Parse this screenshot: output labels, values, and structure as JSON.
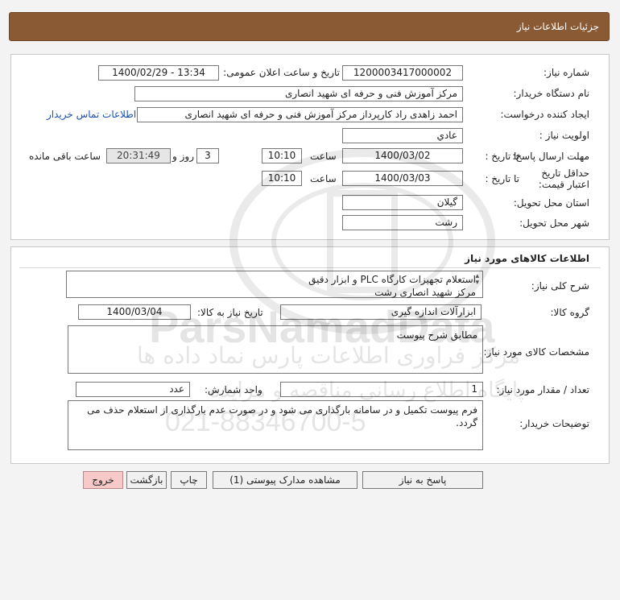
{
  "header": {
    "title": "جزئیات اطلاعات نیاز"
  },
  "info": {
    "need_number_label": "شماره نیاز:",
    "need_number": "1200003417000002",
    "announce_label": "تاریخ و ساعت اعلان عمومی:",
    "announce_value": "1400/02/29 - 13:34",
    "buyer_label": "نام دستگاه خریدار:",
    "buyer_value": "مرکز آموزش فنی و حرفه ای شهید انصاری",
    "creator_label": "ایجاد کننده درخواست:",
    "creator_value": "احمد زاهدی راد کارپرداز مرکز آموزش فنی و حرفه ای شهید انصاری",
    "contact_link": "اطلاعات تماس خریدار",
    "priority_label": "اولویت نیاز :",
    "priority_value": "عادي",
    "deadline_label": "مهلت ارسال پاسخ:",
    "until_date_label": "تا تاریخ :",
    "deadline_date": "1400/03/02",
    "time_label": "ساعت",
    "deadline_time": "10:10",
    "days_value": "3",
    "days_label": "روز و",
    "remaining_time": "20:31:49",
    "remaining_label": "ساعت باقی مانده",
    "validity_label": "حداقل تاریخ اعتبار قیمت:",
    "validity_date": "1400/03/03",
    "validity_time": "10:10",
    "province_label": "استان محل تحویل:",
    "province_value": "گیلان",
    "city_label": "شهر محل تحویل:",
    "city_value": "رشت"
  },
  "goods": {
    "section_title": "اطلاعات کالاهای مورد نیاز",
    "desc_label": "شرح کلی نیاز:",
    "desc_line1": "استعلام  تجهیزات کارگاه PLC و ابزار دقیق",
    "desc_line2": "مرکز شهید انصاری رشت",
    "group_label": "گروه کالا:",
    "group_value": "ابزارآلات اندازه گیری",
    "need_date_label": "تاریخ نیاز به کالا:",
    "need_date_value": "1400/03/04",
    "spec_label": "مشخصات کالای مورد نیاز:",
    "spec_value": "مطابق شرح پیوست",
    "qty_label": "تعداد / مقدار مورد نیاز:",
    "qty_value": "1",
    "unit_label": "واحد شمارش:",
    "unit_value": "عدد",
    "notes_label": "توضیحات خریدار:",
    "notes_value": "فرم پیوست تکمیل و در سامانه بارگذاری می شود و در صورت عدم بارگذاری از استعلام حذف می گردد."
  },
  "actions": {
    "reply": "پاسخ به نیاز",
    "attachments": "مشاهده مدارک پیوستی (1)",
    "print": "چاپ",
    "back": "بازگشت",
    "exit": "خروج"
  },
  "watermark": {
    "brand_en": "ParsNamadData",
    "brand_fa": "مرکز فراوری اطلاعات پارس نماد داده ها",
    "portal_fa": "پایگاه اطلاع رسانی مناقصه و مزایده",
    "phone": "021-88346700-5"
  }
}
